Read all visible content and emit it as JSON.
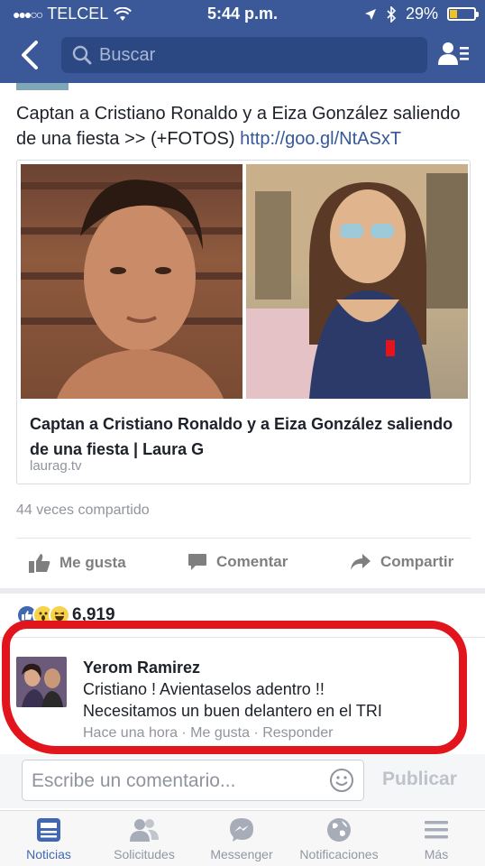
{
  "status": {
    "carrier": "TELCEL",
    "time": "5:44 p.m.",
    "battery": "29%",
    "battery_level": 0.29
  },
  "nav": {
    "search_placeholder": "Buscar"
  },
  "post": {
    "text": "Captan a Cristiano Ronaldo y a Eiza González saliendo de una fiesta >> (+FOTOS)",
    "link": "http://goo.gl/NtASxT",
    "card": {
      "title": "Captan a Cristiano Ronaldo y a Eiza González saliendo de una fiesta | Laura G",
      "domain": "laurag.tv"
    },
    "shares": "44 veces compartido"
  },
  "actions": {
    "like": "Me gusta",
    "comment": "Comentar",
    "share": "Compartir"
  },
  "reactions": {
    "count": "6,919",
    "types": [
      "like",
      "wow",
      "haha"
    ]
  },
  "comment": {
    "author": "Yerom Ramirez",
    "line1": "Cristiano ! Avientaselos adentro !!",
    "line2": "Necesitamos un buen delantero en el TRI",
    "meta": "Hace una hora · Me gusta · Responder"
  },
  "composer": {
    "placeholder": "Escribe un comentario...",
    "publish": "Publicar"
  },
  "tabs": [
    {
      "label": "Noticias",
      "active": true
    },
    {
      "label": "Solicitudes",
      "active": false
    },
    {
      "label": "Messenger",
      "active": false
    },
    {
      "label": "Notificaciones",
      "active": false
    },
    {
      "label": "Más",
      "active": false
    }
  ],
  "colors": {
    "brand": "#3b5998",
    "link": "#365899",
    "annotation_red": "#e2151c"
  }
}
